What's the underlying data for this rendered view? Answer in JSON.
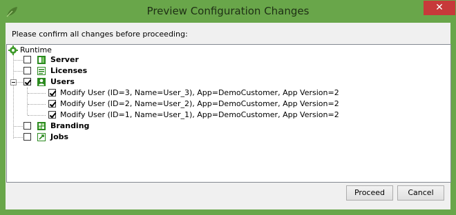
{
  "window": {
    "title": "Preview Configuration Changes",
    "close_glyph": "✕",
    "accent": "#69a64a",
    "close_color": "#c7393a"
  },
  "prompt": "Please confirm all changes before proceeding:",
  "tree": {
    "root": {
      "label": "Runtime",
      "icon": "gear-icon"
    },
    "nodes": [
      {
        "label": "Server",
        "checked": false,
        "icon": "server-icon"
      },
      {
        "label": "Licenses",
        "checked": false,
        "icon": "licenses-icon"
      },
      {
        "label": "Users",
        "checked": true,
        "icon": "users-icon",
        "expanded": true,
        "children": [
          {
            "label": "Modify User (ID=3, Name=User_3), App=DemoCustomer, App Version=2",
            "checked": true
          },
          {
            "label": "Modify User (ID=2, Name=User_2), App=DemoCustomer, App Version=2",
            "checked": true
          },
          {
            "label": "Modify User (ID=1, Name=User_1), App=DemoCustomer, App Version=2",
            "checked": true
          }
        ]
      },
      {
        "label": "Branding",
        "checked": false,
        "icon": "branding-icon"
      },
      {
        "label": "Jobs",
        "checked": false,
        "icon": "jobs-icon"
      }
    ]
  },
  "buttons": {
    "proceed": "Proceed",
    "cancel": "Cancel"
  }
}
